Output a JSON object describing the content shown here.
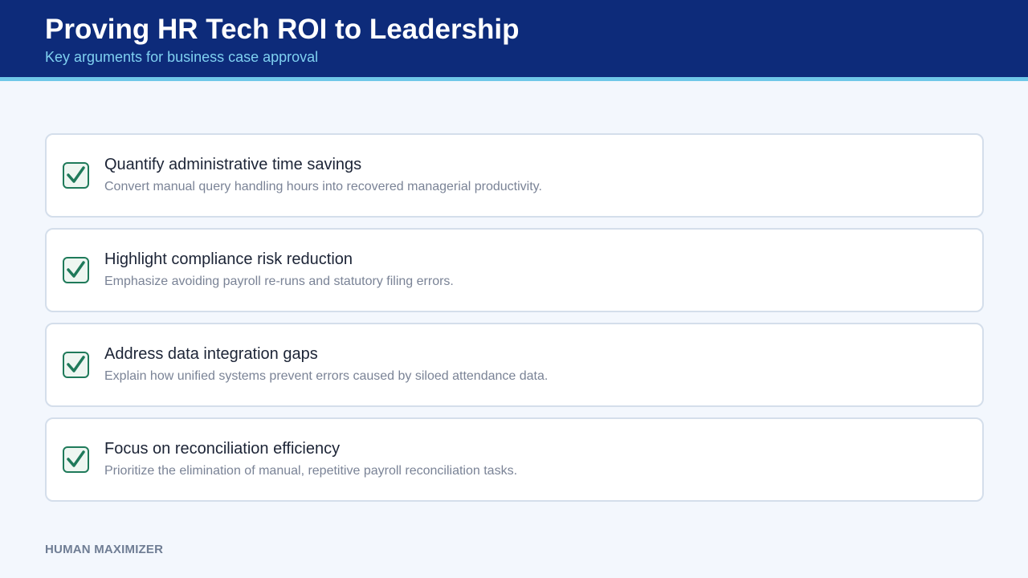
{
  "header": {
    "title": "Proving HR Tech ROI to Leadership",
    "subtitle": "Key arguments for business case approval"
  },
  "items": [
    {
      "icon": "checkbox-checked-icon",
      "title": "Quantify administrative time savings",
      "description": "Convert manual query handling hours into recovered managerial productivity."
    },
    {
      "icon": "checkbox-checked-icon",
      "title": "Highlight compliance risk reduction",
      "description": "Emphasize avoiding payroll re-runs and statutory filing errors."
    },
    {
      "icon": "checkbox-checked-icon",
      "title": "Address data integration gaps",
      "description": "Explain how unified systems prevent errors caused by siloed attendance data."
    },
    {
      "icon": "checkbox-checked-icon",
      "title": "Focus on reconciliation efficiency",
      "description": "Prioritize the elimination of manual, repetitive payroll reconciliation tasks."
    }
  ],
  "footer": {
    "brand": "HUMAN MAXIMIZER"
  },
  "colors": {
    "header_bg": "#0d2b7a",
    "accent": "#6fc7e8",
    "check": "#1f7a5a"
  }
}
